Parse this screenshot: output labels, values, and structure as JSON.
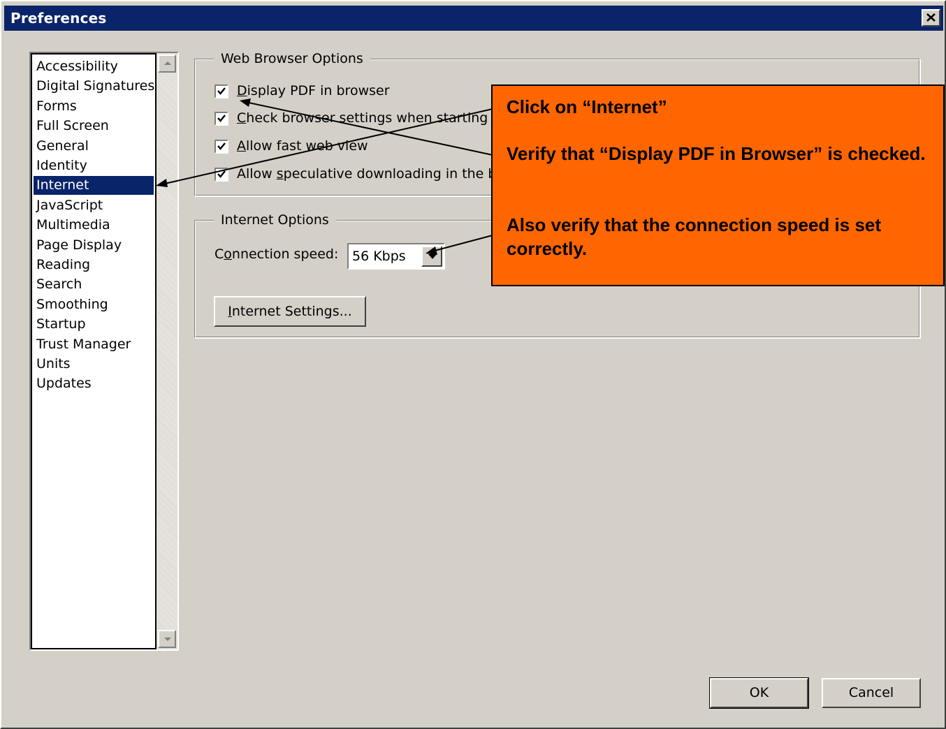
{
  "window": {
    "title": "Preferences"
  },
  "categories": [
    "Accessibility",
    "Digital Signatures",
    "Forms",
    "Full Screen",
    "General",
    "Identity",
    "Internet",
    "JavaScript",
    "Multimedia",
    "Page Display",
    "Reading",
    "Search",
    "Smoothing",
    "Startup",
    "Trust Manager",
    "Units",
    "Updates"
  ],
  "selected_category": "Internet",
  "web_browser_options": {
    "legend": "Web Browser Options",
    "display_pdf": {
      "pre": "",
      "u": "D",
      "post": "isplay PDF in browser",
      "checked": true
    },
    "check_browser": {
      "pre": "",
      "u": "C",
      "post": "heck browser settings when starting R",
      "checked": true
    },
    "fast_web_view": {
      "pre": "",
      "u": "A",
      "post": "llow fast web view",
      "checked": true
    },
    "speculative": {
      "pre": "Allow ",
      "u": "s",
      "post": "peculative downloading in the ba",
      "checked": true
    }
  },
  "internet_options": {
    "legend": "Internet Options",
    "connection_speed": {
      "pre": "C",
      "u": "o",
      "post": "nnection speed:"
    },
    "speed_value": "56 Kbps",
    "settings_button": {
      "pre": "",
      "u": "I",
      "post": "nternet Settings..."
    }
  },
  "buttons": {
    "ok": "OK",
    "cancel": "Cancel"
  },
  "callout": {
    "line1": "Click on “Internet”",
    "line2": "Verify that “Display PDF in Browser” is checked.",
    "line3": "Also verify that the connection speed is set correctly."
  },
  "colors": {
    "title_bar": "#0a246a",
    "dialog_bg": "#d4d0c8",
    "callout_bg": "#ff6600",
    "selection": "#0a246a"
  }
}
